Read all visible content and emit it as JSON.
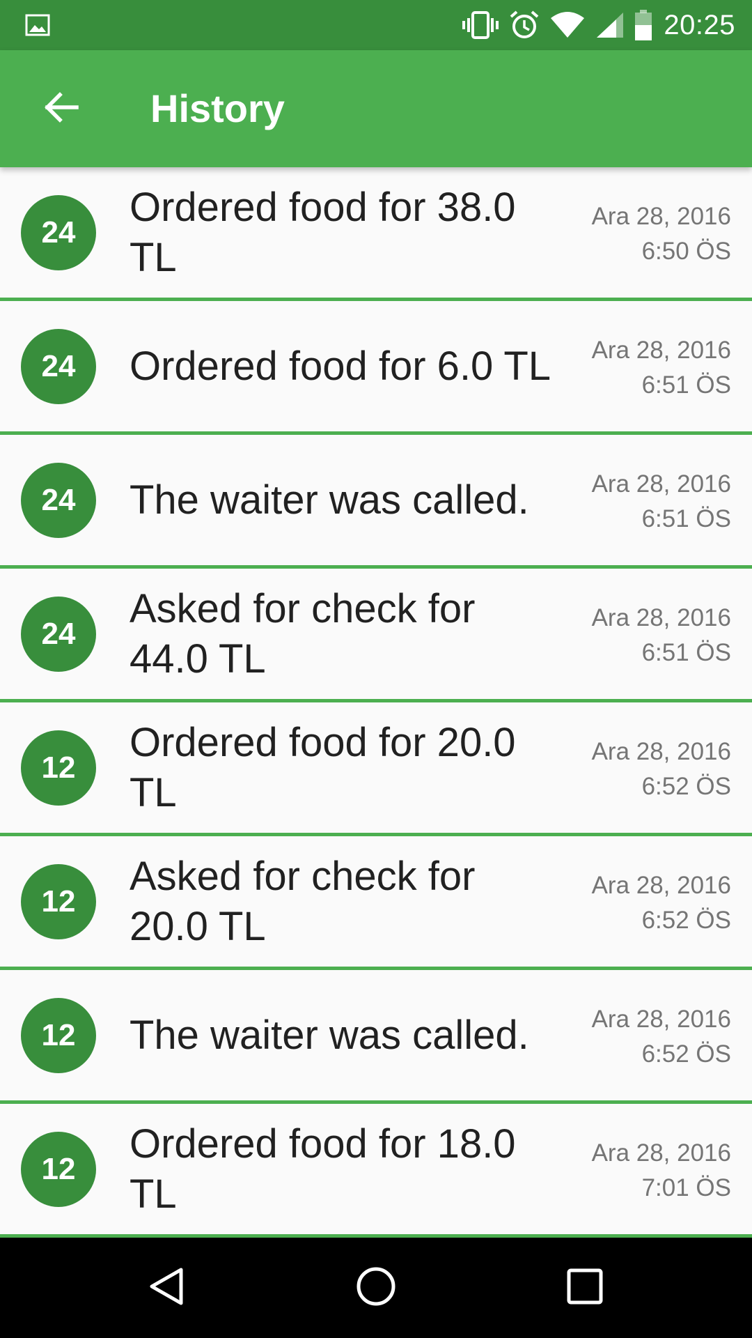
{
  "status_bar": {
    "time": "20:25",
    "icons": [
      "image-icon",
      "vibrate-icon",
      "alarm-icon",
      "wifi-icon",
      "signal-icon",
      "battery-icon"
    ]
  },
  "app_bar": {
    "title": "History",
    "back_icon": "arrow-back-icon"
  },
  "colors": {
    "status_bar": "#388e3c",
    "app_bar": "#4caf50",
    "badge": "#388e3c",
    "divider": "#4caf50"
  },
  "history": [
    {
      "table": "24",
      "text": "Ordered food for 38.0 TL",
      "date": "Ara 28, 2016",
      "time": "6:50 ÖS"
    },
    {
      "table": "24",
      "text": "Ordered food for 6.0 TL",
      "date": "Ara 28, 2016",
      "time": "6:51 ÖS"
    },
    {
      "table": "24",
      "text": "The waiter was called.",
      "date": "Ara 28, 2016",
      "time": "6:51 ÖS"
    },
    {
      "table": "24",
      "text": "Asked for check for 44.0 TL",
      "date": "Ara 28, 2016",
      "time": "6:51 ÖS"
    },
    {
      "table": "12",
      "text": "Ordered food for 20.0 TL",
      "date": "Ara 28, 2016",
      "time": "6:52 ÖS"
    },
    {
      "table": "12",
      "text": "Asked for check for 20.0 TL",
      "date": "Ara 28, 2016",
      "time": "6:52 ÖS"
    },
    {
      "table": "12",
      "text": "The waiter was called.",
      "date": "Ara 28, 2016",
      "time": "6:52 ÖS"
    },
    {
      "table": "12",
      "text": "Ordered food for 18.0 TL",
      "date": "Ara 28, 2016",
      "time": "7:01 ÖS"
    }
  ],
  "nav_bar": {
    "icons": [
      "back-triangle-icon",
      "home-circle-icon",
      "recents-square-icon"
    ]
  }
}
